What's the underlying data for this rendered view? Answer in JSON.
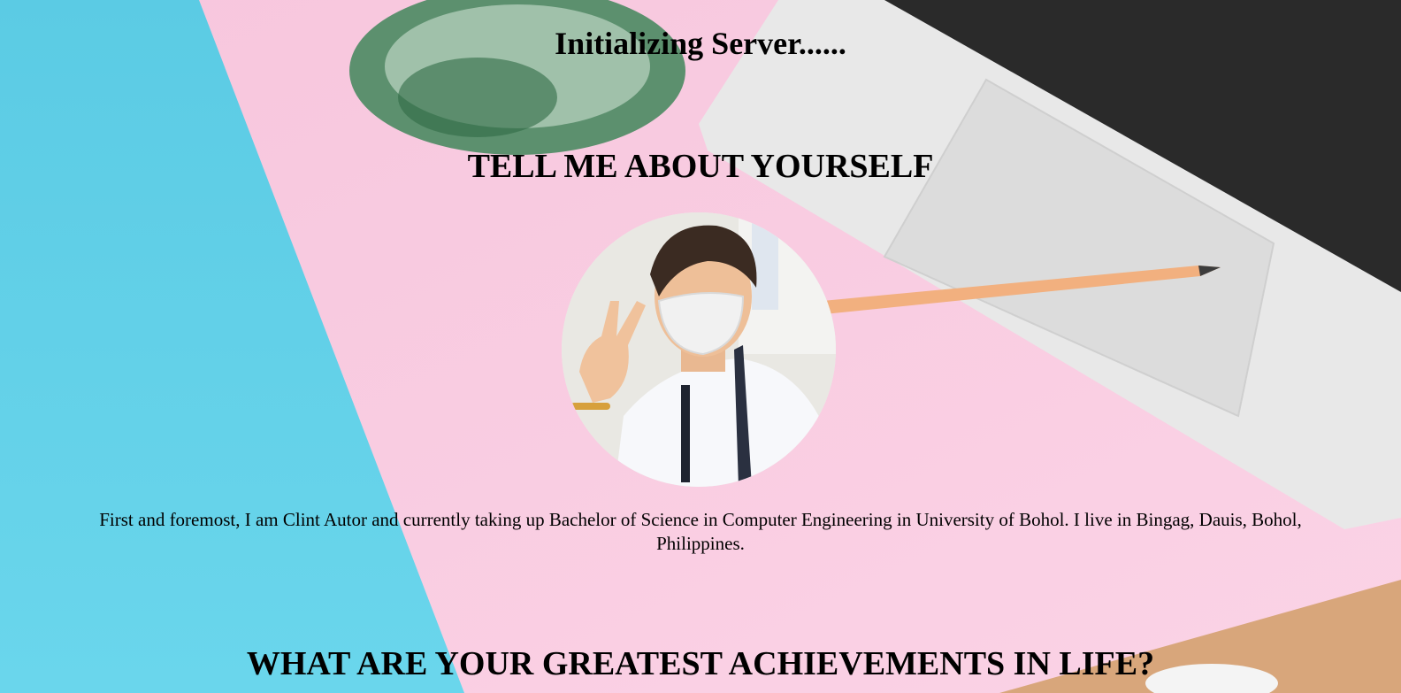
{
  "status": {
    "text": "Initializing Server......"
  },
  "about": {
    "heading": "TELL ME ABOUT YOURSELF",
    "intro": "First and foremost, I am Clint Autor and currently taking up Bachelor of Science in Computer Engineering in University of Bohol. I live in Bingag, Dauis, Bohol, Philippines."
  },
  "achievements": {
    "heading": "WHAT ARE YOUR GREATEST ACHIEVEMENTS IN LIFE?"
  },
  "background": {
    "colors": {
      "blue": "#5ccde6",
      "pink": "#f9cbe1",
      "laptop": "#e6e6e6",
      "keys": "#222222",
      "pencil": "#f0b07d",
      "plant": "#3f7a55",
      "box": "#d9a47a"
    },
    "items": [
      "plant",
      "laptop",
      "pencil",
      "cardboard-box"
    ]
  },
  "profile": {
    "image": "profile-photo"
  }
}
